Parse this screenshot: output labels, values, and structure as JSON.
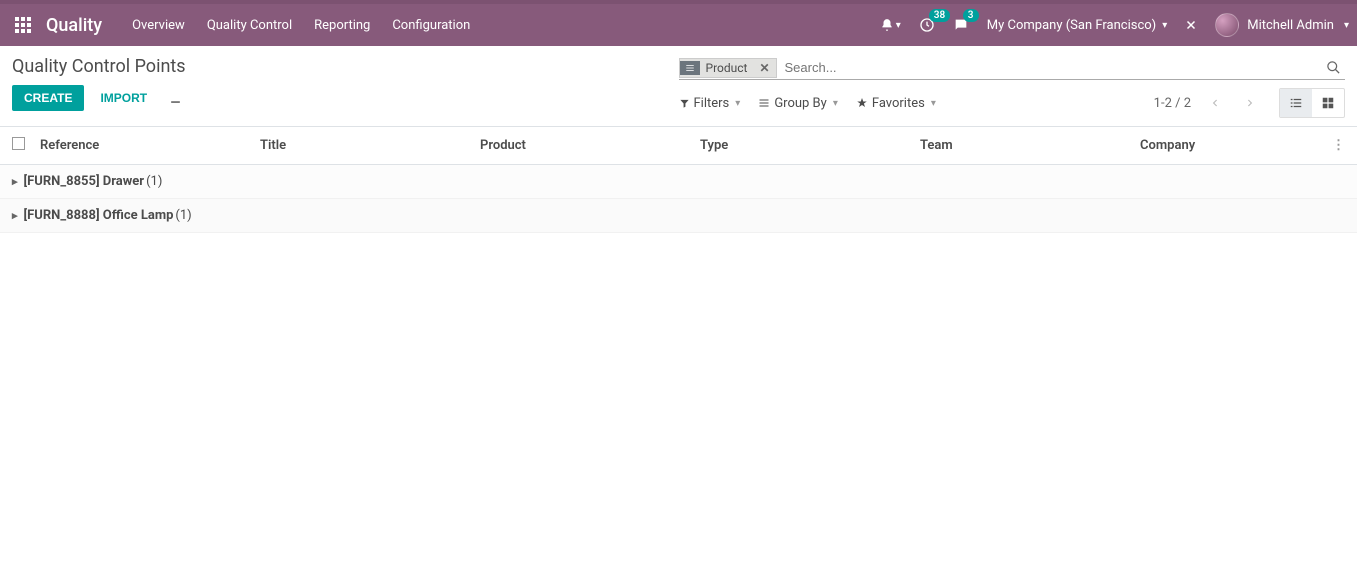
{
  "topbar": {
    "app_name": "Quality",
    "nav": [
      "Overview",
      "Quality Control",
      "Reporting",
      "Configuration"
    ],
    "activities_badge": "38",
    "discuss_badge": "3",
    "company": "My Company (San Francisco)",
    "user": "Mitchell Admin"
  },
  "breadcrumb": "Quality Control Points",
  "buttons": {
    "create": "CREATE",
    "import": "IMPORT"
  },
  "search": {
    "tag_label": "Product",
    "placeholder": "Search..."
  },
  "toolbar": {
    "filters": "Filters",
    "groupby": "Group By",
    "favorites": "Favorites",
    "pager": "1-2 / 2"
  },
  "columns": {
    "reference": "Reference",
    "title": "Title",
    "product": "Product",
    "type": "Type",
    "team": "Team",
    "company": "Company"
  },
  "groups": [
    {
      "label": "[FURN_8855] Drawer",
      "count": "(1)"
    },
    {
      "label": "[FURN_8888] Office Lamp",
      "count": "(1)"
    }
  ]
}
